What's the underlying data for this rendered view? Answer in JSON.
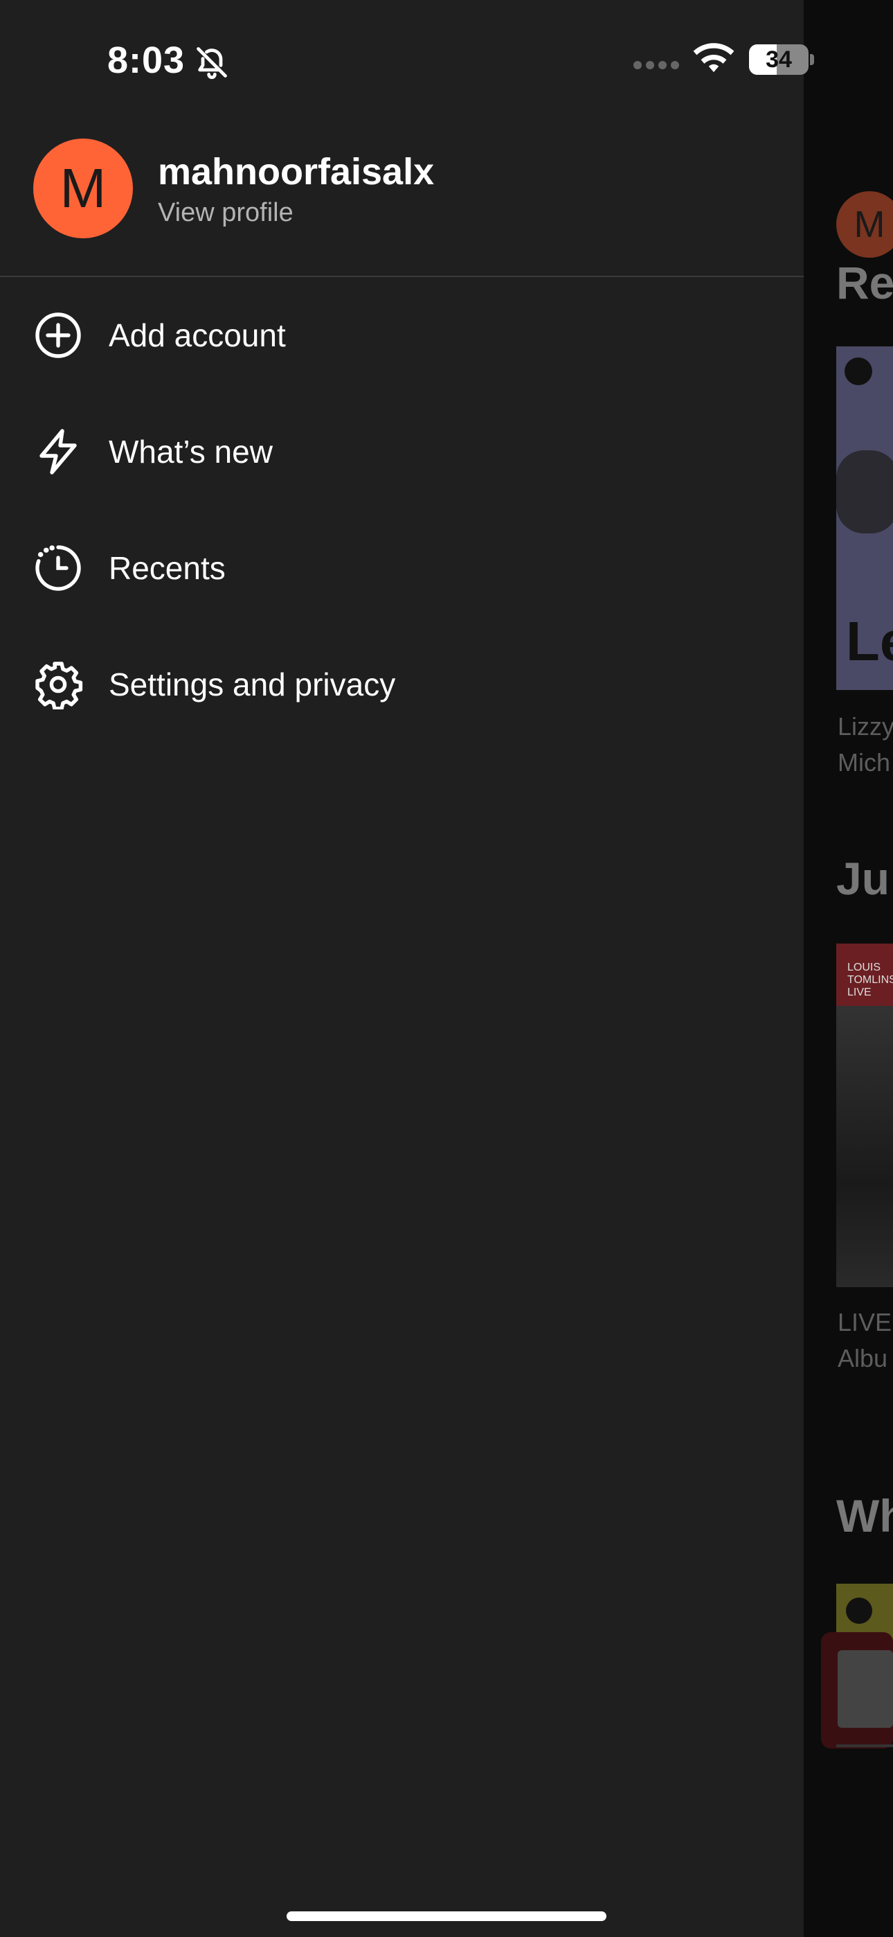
{
  "status_bar": {
    "time": "8:03",
    "battery": "34"
  },
  "profile": {
    "avatar_letter": "M",
    "name": "mahnoorfaisalx",
    "link": "View profile"
  },
  "menu": {
    "items": [
      {
        "label": "Add account",
        "icon": "add-circle-icon"
      },
      {
        "label": "What’s new",
        "icon": "lightning-icon"
      },
      {
        "label": "Recents",
        "icon": "recent-clock-icon"
      },
      {
        "label": "Settings and privacy",
        "icon": "gear-icon"
      }
    ]
  },
  "background": {
    "avatar_letter": "M",
    "headings": [
      "Re",
      "Ju",
      "Wh"
    ],
    "cover_text": "Le",
    "cover2_text": "LOUIS TOMLINSON LIVE",
    "subtitles": [
      "Lizzy",
      "Mich",
      "LIVE",
      "Albu"
    ]
  },
  "colors": {
    "drawer_bg": "#1f1f1f",
    "avatar": "#ff6437",
    "divider": "#3a3a3a"
  }
}
